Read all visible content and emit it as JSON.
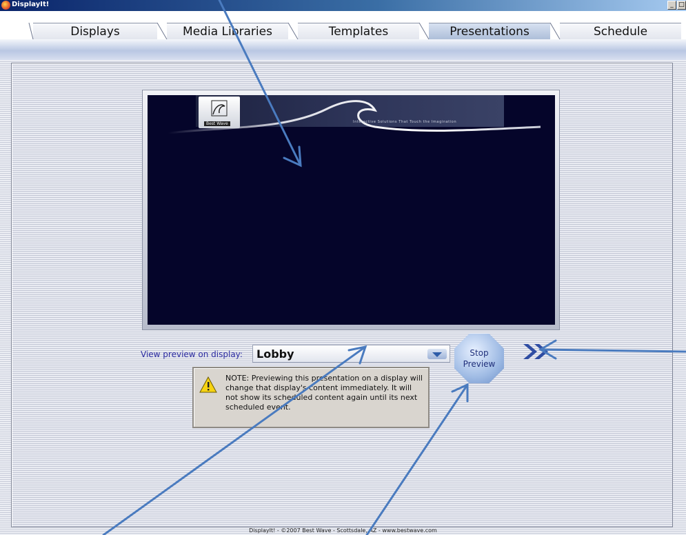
{
  "window": {
    "title": "DisplayIt!",
    "buttons": [
      "minimize",
      "maximize"
    ]
  },
  "tabs": [
    {
      "label": "Displays",
      "active": false
    },
    {
      "label": "Media Libraries",
      "active": false
    },
    {
      "label": "Templates",
      "active": false
    },
    {
      "label": "Presentations",
      "active": true
    },
    {
      "label": "Schedule",
      "active": false
    }
  ],
  "preview": {
    "logo_text": "Best Wave",
    "tagline": "Interactive Solutions That Touch the Imagination"
  },
  "controls": {
    "view_label": "View preview on display:",
    "display_value": "Lobby",
    "stop_line1": "Stop",
    "stop_line2": "Preview"
  },
  "note": {
    "text": "NOTE: Previewing this presentation on a display will change that display's content immediately.  It will not show its scheduled content again until its next scheduled event."
  },
  "footer": {
    "text": "DisplayIt! - ©2007 Best Wave - Scottsdale, AZ - www.bestwave.com"
  },
  "colors": {
    "screen_bg": "#05052a",
    "title_bar": "#0a246a",
    "annotation_arrow": "#4a7bbf"
  }
}
